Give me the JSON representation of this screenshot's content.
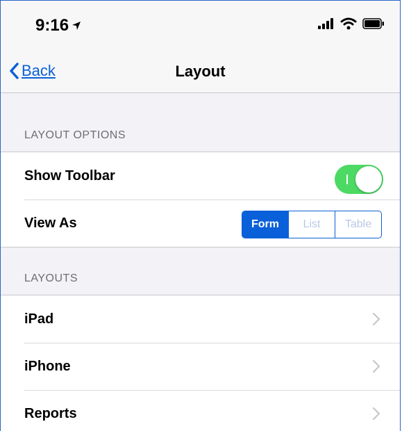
{
  "status_bar": {
    "time": "9:16"
  },
  "nav": {
    "back_label": "Back",
    "title": "Layout"
  },
  "layout_options": {
    "header": "LAYOUT OPTIONS",
    "show_toolbar_label": "Show Toolbar",
    "show_toolbar_on": true,
    "view_as_label": "View As",
    "view_as_options": [
      "Form",
      "List",
      "Table"
    ],
    "view_as_selected": "Form"
  },
  "layouts": {
    "header": "LAYOUTS",
    "items": [
      {
        "label": "iPad"
      },
      {
        "label": "iPhone"
      },
      {
        "label": "Reports"
      }
    ]
  },
  "colors": {
    "accent": "#0a60d8",
    "toggle_on": "#4cd964",
    "grouped_background": "#f2f2f7"
  }
}
